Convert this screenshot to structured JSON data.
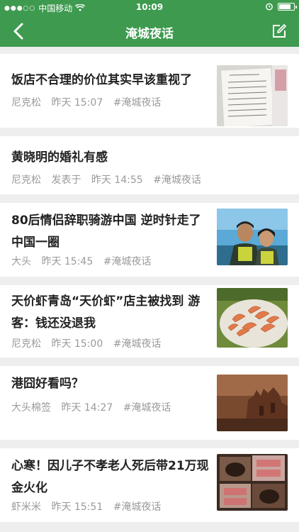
{
  "status_bar": {
    "carrier": "中国移动",
    "time": "10:09",
    "battery_level": 0.85
  },
  "nav": {
    "title": "淹城夜话",
    "back_icon": "chevron-left-icon",
    "edit_icon": "edit-icon"
  },
  "posts": [
    {
      "title": "饭店不合理的价位其实早该重视了",
      "author": "尼克松",
      "time": "昨天 15:07",
      "tag": "#淹城夜话",
      "thumbnail": "receipt"
    },
    {
      "title": "黄晓明的婚礼有感",
      "author": "尼克松",
      "prefix": "发表于",
      "time": "昨天 14:55",
      "tag": "#淹城夜话"
    },
    {
      "title": "80后情侣辞职骑游中国 逆时针走了中国一圈",
      "author": "大头",
      "time": "昨天 15:45",
      "tag": "#淹城夜话",
      "thumbnail": "couple"
    },
    {
      "title": "天价虾青岛“天价虾”店主被找到 游客：钱还没退我",
      "author": "尼克松",
      "time": "昨天 15:00",
      "tag": "#淹城夜话",
      "thumbnail": "shrimp"
    },
    {
      "title": "港囧好看吗？",
      "author": "大头棉签",
      "time": "昨天 14:27",
      "tag": "#淹城夜话",
      "thumbnail": "ruins"
    },
    {
      "title": "心寒！因儿子不孝老人死后带21万现金火化",
      "author": "虾米米",
      "time": "昨天 15:51",
      "tag": "#淹城夜话",
      "thumbnail": "cash"
    }
  ],
  "colors": {
    "header_green": "#3e9a4f",
    "title_text": "#222222",
    "meta_text": "#9a9a9a",
    "background": "#eeeeee"
  }
}
